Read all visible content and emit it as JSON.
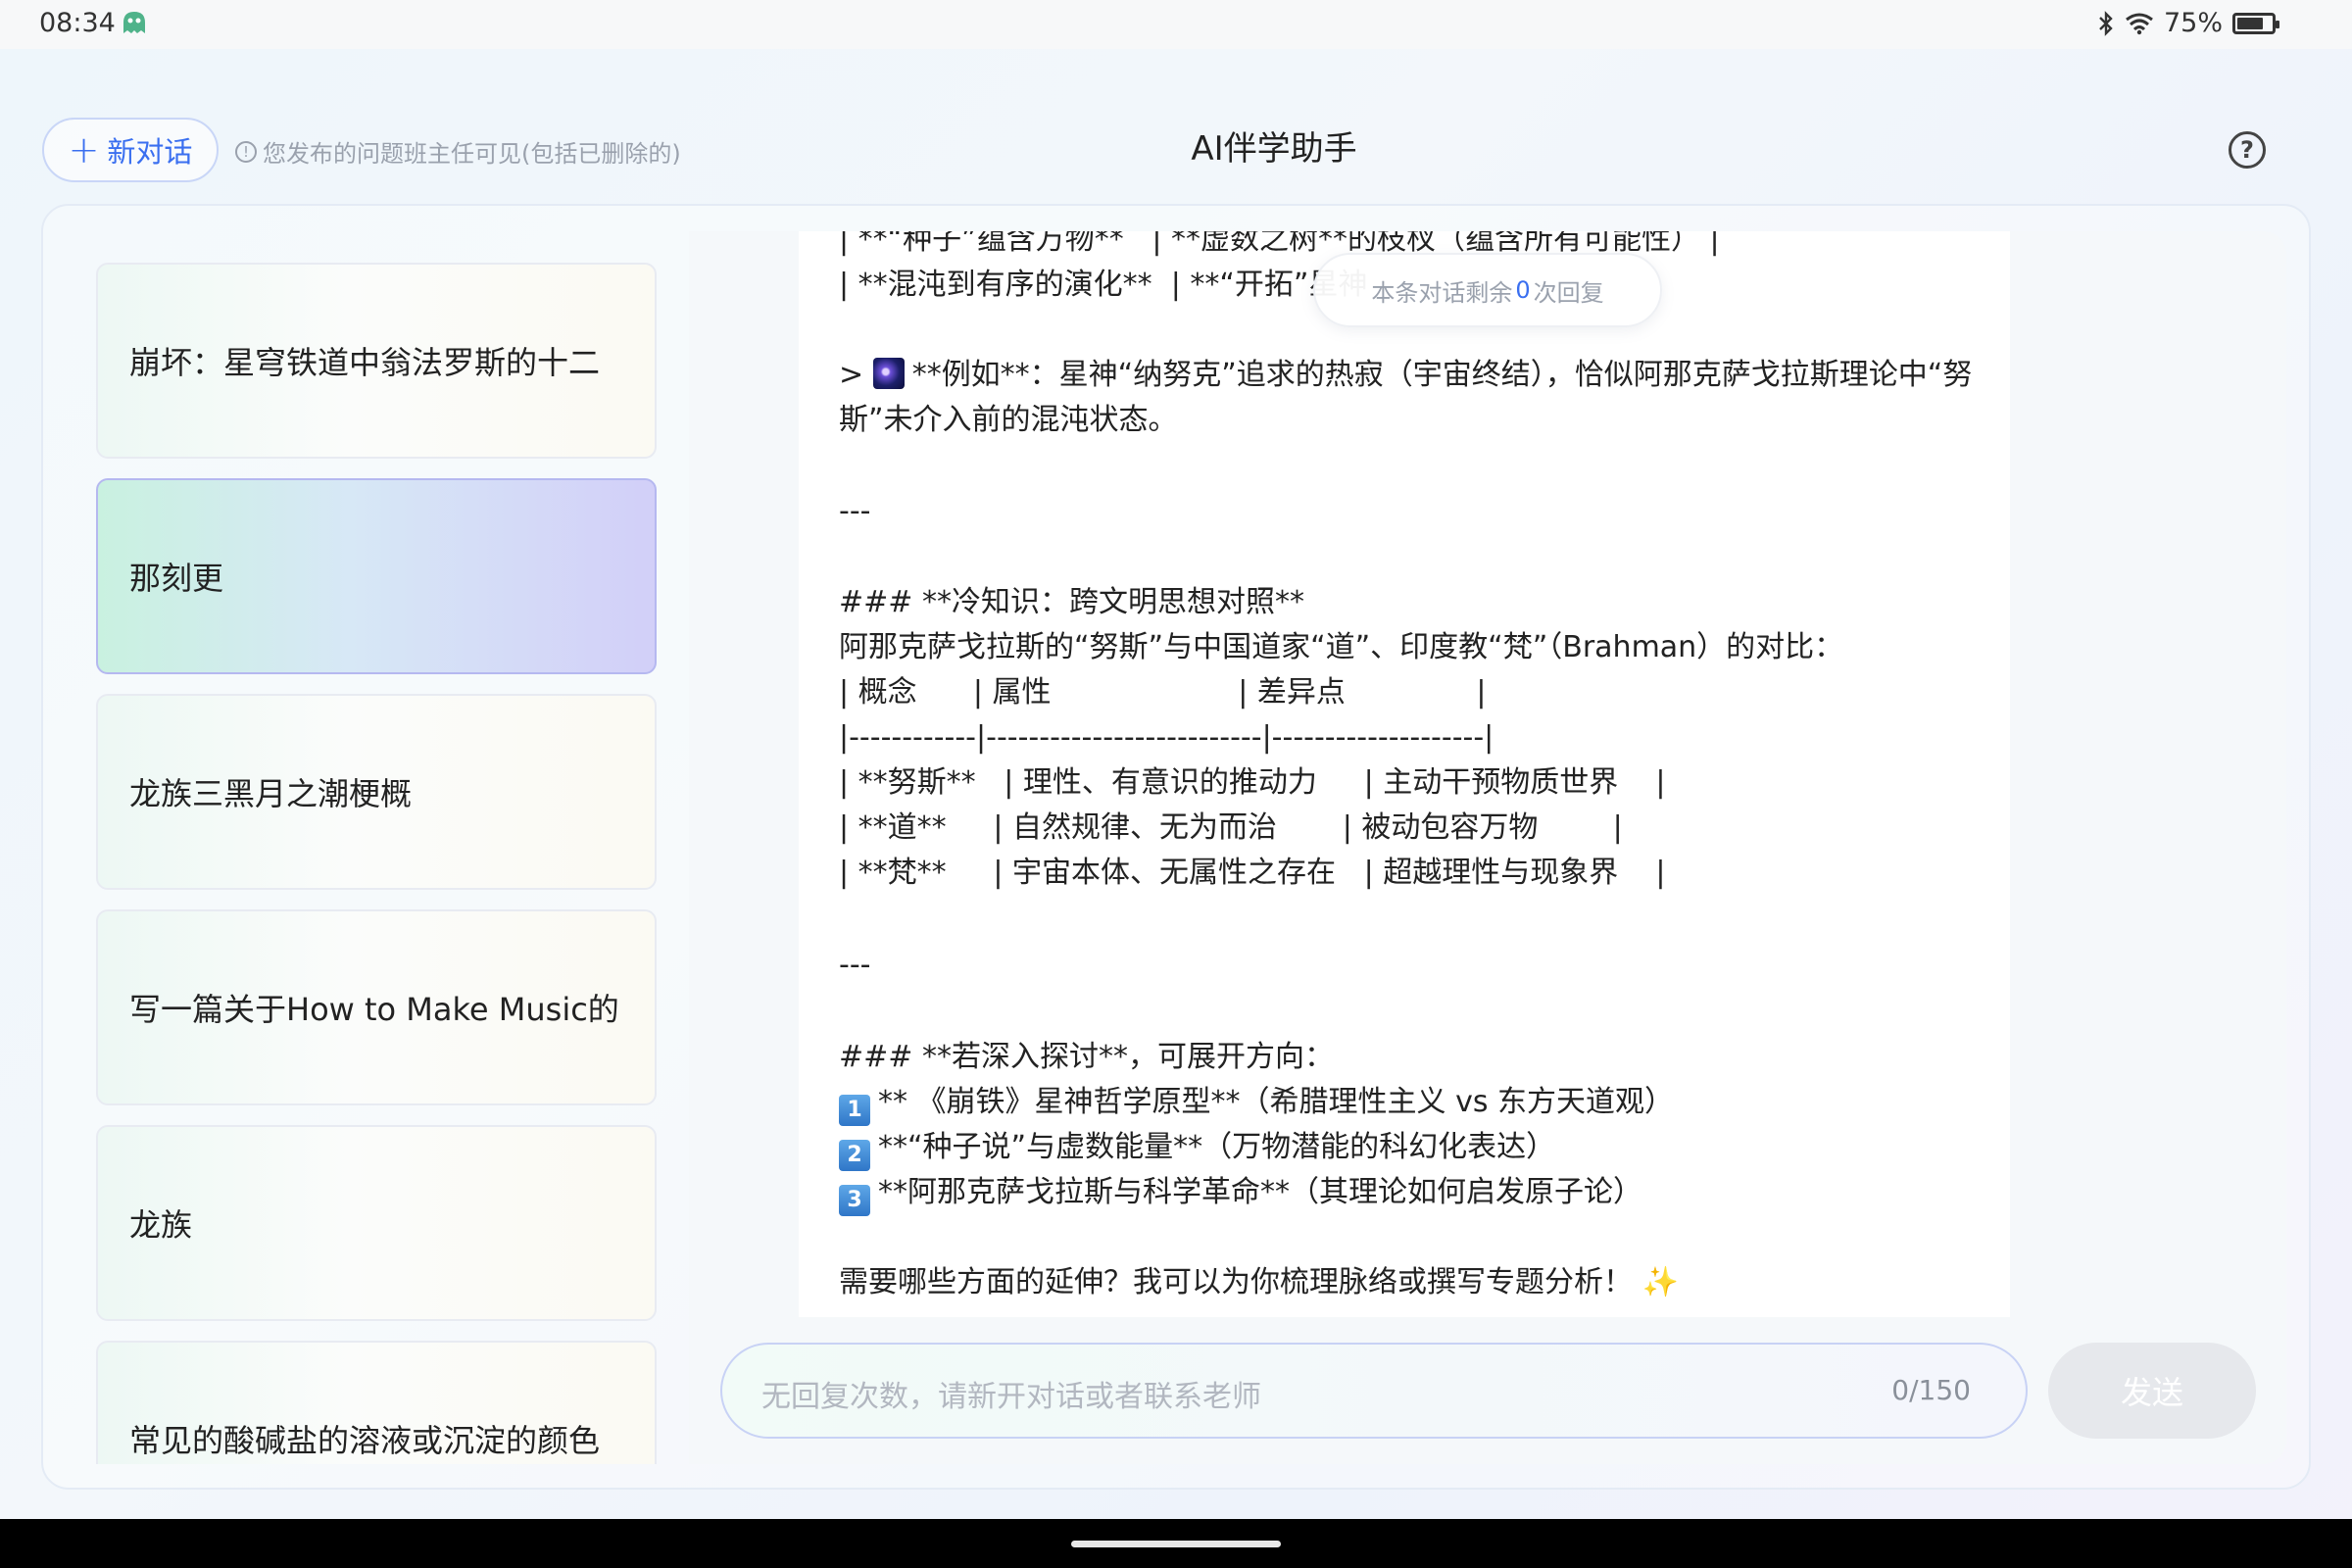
{
  "status_bar": {
    "time": "08:34",
    "battery": "75%",
    "battery_level": 0.75
  },
  "header": {
    "new_chat_label": "新对话",
    "notice": "您发布的问题班主任可见(包括已删除的)",
    "title": "AI伴学助手"
  },
  "conversations": [
    {
      "title": "崩坏：星穹铁道中翁法罗斯的十二",
      "active": false
    },
    {
      "title": "那刻更",
      "active": true
    },
    {
      "title": "龙族三黑月之潮梗概",
      "active": false
    },
    {
      "title": "写一篇关于How to Make Music的",
      "active": false
    },
    {
      "title": "龙族",
      "active": false
    },
    {
      "title": "常见的酸碱盐的溶液或沉淀的颜色",
      "active": false
    }
  ],
  "toast": {
    "prefix": "本条对话剩余",
    "count": "0",
    "suffix": "次回复"
  },
  "message_lines": [
    "| **“种子”蕴含万物**   | **虚数之树**的枝杈（蕴含所有可能性） |",
    "| **混沌到有序的演化**  | **“开拓”星神",
    "> ",
    "**例如**：星神“纳努克”追求的热寂（宇宙终结），恰似阿那克萨戈拉斯理论中“努",
    "斯”未介入前的混沌状态。",
    "---",
    "### **冷知识：跨文明思想对照**",
    "阿那克萨戈拉斯的“努斯”与中国道家“道”、印度教“梵”（Brahman）的对比：",
    "| 概念      | 属性                    | 差异点              |",
    "|------------|--------------------------|--------------------|",
    "| **努斯**   | 理性、有意识的推动力     | 主动干预物质世界    |",
    "| **道**     | 自然规律、无为而治       | 被动包容万物        |",
    "| **梵**     | 宇宙本体、无属性之存在   | 超越理性与现象界    |",
    "---",
    "### **若深入探讨**，可展开方向：",
    "1",
    "** 《崩铁》星神哲学原型**（希腊理性主义 vs 东方天道观）",
    "2",
    "**“种子说”与虚数能量**（万物潜能的科幻化表达）",
    "3",
    "**阿那克萨戈拉斯与科学革命**（其理论如何启发原子论）",
    "需要哪些方面的延伸？我可以为你梳理脉络或撰写专题分析！ ✨"
  ],
  "input": {
    "placeholder": "无回复次数，请新开对话或者联系老师",
    "counter": "0/150"
  },
  "send_label": "发送",
  "colors": {
    "accent": "#3a6ff0",
    "active_item_from": "#c9f1e0",
    "active_item_to": "#d2cff8"
  },
  "icons": [
    "ghost-app-icon",
    "bluetooth-icon",
    "wifi-icon",
    "battery-icon",
    "plus-icon",
    "info-icon",
    "help-icon",
    "galaxy-emoji-icon",
    "keycap-icon",
    "sparkles-emoji-icon"
  ]
}
